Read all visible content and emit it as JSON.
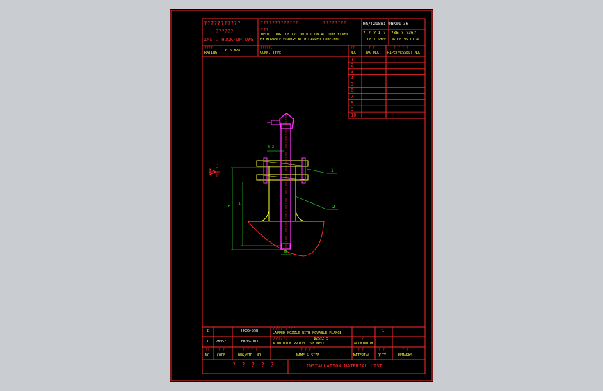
{
  "title_block": {
    "cn_title_1": "???????????",
    "cn_title_2": "??????",
    "en_title": "INST. HOOK-UP DWG",
    "desc_cn": "?????????????",
    "desc_cn_2": ".????????",
    "desc_cn_3": "???",
    "desc_en_1": "INSTL. DWG. OF T/C OR RTD ON AL TUBE FIXED",
    "desc_en_2": "BY MOVABLE FLANGE WITH LAPPED TUBE-END",
    "std_no": "HG/T21581-95",
    "dwg_no": "HK01-36",
    "sheet_cn": "? ? ? 1 ?",
    "sheet_en": "1 OF 1 SHEET",
    "total_cn": "?36 ? ?36?",
    "total_en": "36 OF 36 TOTAL",
    "rating_cn": "????",
    "rating_en": "RATING",
    "rating_value": "0.6 MPa",
    "conn_cn": "?????:",
    "conn_en": "CONN. TYPE"
  },
  "tag_table": {
    "headers_cn": [
      "??",
      "?  ?",
      "?  ?  ?  ?"
    ],
    "headers_en": [
      "NO.",
      "TAG NO.",
      "PIPE(VESSEL) NO."
    ],
    "rows": [
      "1",
      "2",
      "3",
      "4",
      "5",
      "6",
      "7",
      "8",
      "9",
      "10"
    ]
  },
  "drawing": {
    "dim_delta": "δ+2",
    "label_j": "J",
    "label_p": "P",
    "callout_1": "1",
    "callout_2": "2",
    "dim_h": "H",
    "dim_l": "l",
    "dim_d": "d"
  },
  "material_list": {
    "rows": [
      {
        "no": "2",
        "code": "",
        "std": "HK05-55B",
        "name_cn": "?????????",
        "name_en": "LAPPED NOZZLE WITH MOVABLE FLANGE",
        "material_cn": "",
        "material_en": "",
        "qty": "1",
        "remarks": ""
      },
      {
        "no": "1",
        "code": "PM052",
        "std": "HK06-D03",
        "name_cn": "??????",
        "name_en": "ALUMINIUM PROTECTIVE WELL",
        "name_extra": "φ25×2.5",
        "material_cn": "?",
        "material_en": "ALUMINIUM",
        "qty": "1",
        "remarks": ""
      }
    ],
    "headers_cn": [
      "??",
      "? ?",
      "? ? ? ?",
      "? ? ? ?",
      "? ?",
      "? ?",
      "? ?"
    ],
    "headers_en": [
      "NO.",
      "CODE",
      "DWG/STD. NO.",
      "NAME & SIZE",
      "MATERIAL",
      "Q'TY",
      "REMARKS"
    ],
    "footer_cn": "? ? ? ? ?",
    "footer_en": "INSTALLATION MATERIAL LIST"
  },
  "colors": {
    "frame": "#ff2a2a",
    "text_yellow": "#ffff33",
    "text_green": "#33ff33",
    "part": "#ff33ff",
    "aux": "#ffff33",
    "background": "#000000",
    "viewport": "#c9ccd0"
  }
}
